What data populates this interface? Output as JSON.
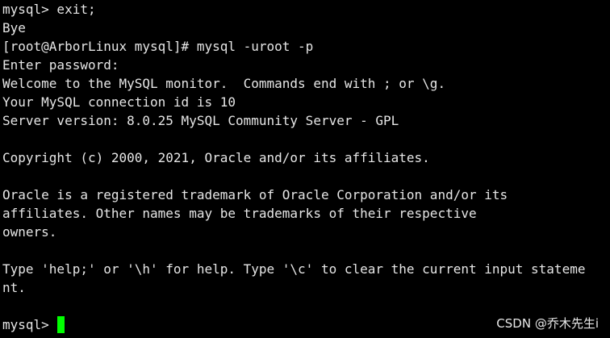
{
  "terminal": {
    "lines": [
      "mysql> exit;",
      "Bye",
      "[root@ArborLinux mysql]# mysql -uroot -p",
      "Enter password:",
      "Welcome to the MySQL monitor.  Commands end with ; or \\g.",
      "Your MySQL connection id is 10",
      "Server version: 8.0.25 MySQL Community Server - GPL",
      "",
      "Copyright (c) 2000, 2021, Oracle and/or its affiliates.",
      "",
      "Oracle is a registered trademark of Oracle Corporation and/or its",
      "affiliates. Other names may be trademarks of their respective",
      "owners.",
      "",
      "Type 'help;' or '\\h' for help. Type '\\c' to clear the current input stateme",
      "nt.",
      ""
    ],
    "prompt": "mysql> ",
    "cursor_color": "#00ff00",
    "background_color": "#000000",
    "text_color": "#e6e6e6"
  },
  "watermark": {
    "text": "CSDN @乔木先生i"
  }
}
